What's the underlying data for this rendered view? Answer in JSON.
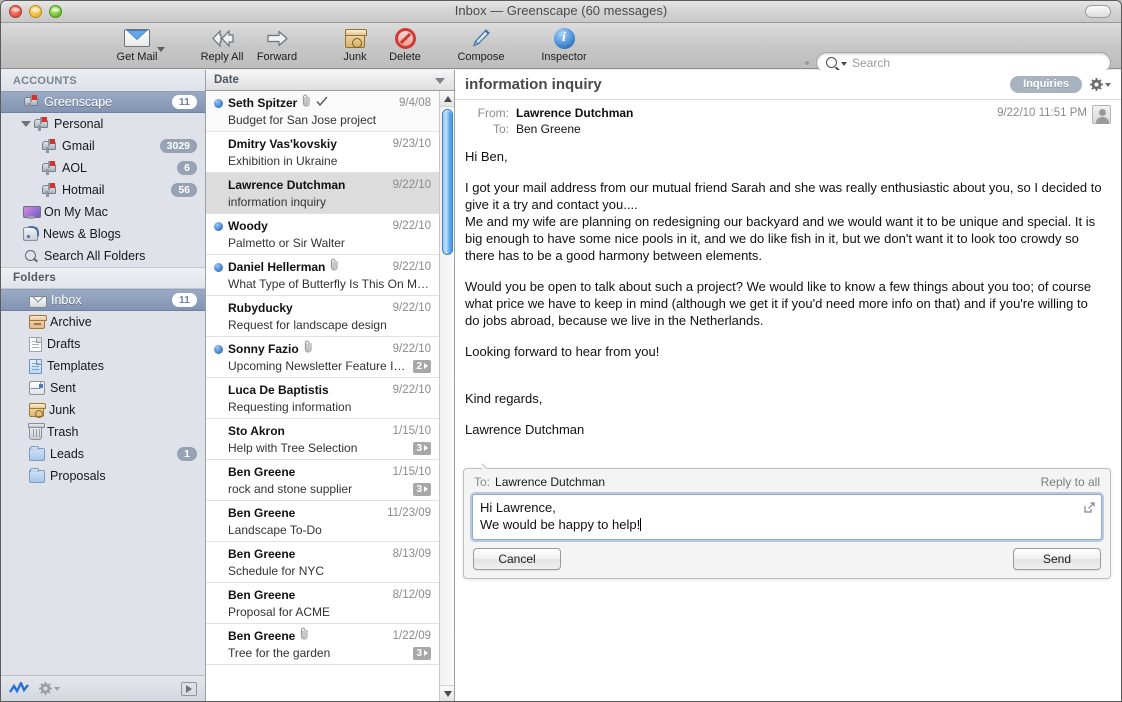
{
  "window": {
    "title": "Inbox — Greenscape (60 messages)"
  },
  "toolbar": {
    "items": [
      {
        "label": "Get Mail",
        "icon": "envelope-icon"
      },
      {
        "label": "Reply All",
        "icon": "double-arrow-left-icon"
      },
      {
        "label": "Forward",
        "icon": "arrow-right-icon"
      },
      {
        "label": "Junk",
        "icon": "junk-box-icon"
      },
      {
        "label": "Delete",
        "icon": "delete-circle-icon"
      },
      {
        "label": "Compose",
        "icon": "pen-icon"
      },
      {
        "label": "Inspector",
        "icon": "info-icon"
      }
    ],
    "search_placeholder": "Search"
  },
  "sidebar": {
    "accounts_header": "ACCOUNTS",
    "accounts": [
      {
        "label": "Greenscape",
        "badge": "11",
        "icon": "mailbox-icon",
        "indent": 1,
        "selected": true
      },
      {
        "label": "Personal",
        "badge": "",
        "icon": "mailbox-icon",
        "indent": 1,
        "disclosure": true
      },
      {
        "label": "Gmail",
        "badge": "3029",
        "icon": "mailbox-icon",
        "indent": 2
      },
      {
        "label": "AOL",
        "badge": "6",
        "icon": "mailbox-icon",
        "indent": 2
      },
      {
        "label": "Hotmail",
        "badge": "56",
        "icon": "mailbox-icon",
        "indent": 2
      },
      {
        "label": "On My Mac",
        "badge": "",
        "icon": "screen-icon",
        "indent": 1
      },
      {
        "label": "News & Blogs",
        "badge": "",
        "icon": "rss-icon",
        "indent": 1
      },
      {
        "label": "Search All Folders",
        "badge": "",
        "icon": "magnifier-icon",
        "indent": 1
      }
    ],
    "folders_header": "Folders",
    "folders": [
      {
        "label": "Inbox",
        "badge": "11",
        "icon": "inbox-tray-icon",
        "selected": true
      },
      {
        "label": "Archive",
        "badge": "",
        "icon": "archive-box-icon"
      },
      {
        "label": "Drafts",
        "badge": "",
        "icon": "document-icon"
      },
      {
        "label": "Templates",
        "badge": "",
        "icon": "document-blue-icon"
      },
      {
        "label": "Sent",
        "badge": "",
        "icon": "sent-envelope-icon"
      },
      {
        "label": "Junk",
        "badge": "",
        "icon": "junk-box-icon"
      },
      {
        "label": "Trash",
        "badge": "",
        "icon": "trash-icon"
      },
      {
        "label": "Leads",
        "badge": "1",
        "icon": "folder-icon"
      },
      {
        "label": "Proposals",
        "badge": "",
        "icon": "folder-icon"
      }
    ],
    "status_bar": {
      "activity_icon": "activity-chart-icon",
      "gear_icon": "gear-icon",
      "expand_icon": "show-pane-icon"
    }
  },
  "message_list": {
    "column_header": "Date",
    "rows": [
      {
        "sender": "Seth Spitzer",
        "subject": "Budget for San Jose project",
        "date": "9/4/08",
        "unread": true,
        "attachment": true,
        "replied": true,
        "thread": "",
        "selected": false
      },
      {
        "sender": "Dmitry Vas'kovskiy",
        "subject": "Exhibition in Ukraine",
        "date": "9/23/10",
        "unread": false,
        "attachment": false,
        "replied": false,
        "thread": "",
        "selected": false
      },
      {
        "sender": "Lawrence Dutchman",
        "subject": "information inquiry",
        "date": "9/22/10",
        "unread": false,
        "attachment": false,
        "replied": false,
        "thread": "",
        "selected": true
      },
      {
        "sender": "Woody",
        "subject": "Palmetto or Sir Walter",
        "date": "9/22/10",
        "unread": true,
        "attachment": false,
        "replied": false,
        "thread": "",
        "selected": false
      },
      {
        "sender": "Daniel Hellerman",
        "subject": "What Type of Butterfly Is This On M…",
        "date": "9/22/10",
        "unread": true,
        "attachment": true,
        "replied": false,
        "thread": "",
        "selected": false
      },
      {
        "sender": "Rubyducky",
        "subject": "Request for landscape design",
        "date": "9/22/10",
        "unread": false,
        "attachment": false,
        "replied": false,
        "thread": "",
        "selected": false
      },
      {
        "sender": "Sonny Fazio",
        "subject": "Upcoming Newsletter Feature I…",
        "date": "9/22/10",
        "unread": true,
        "attachment": true,
        "replied": false,
        "thread": "2",
        "selected": false
      },
      {
        "sender": "Luca De Baptistis",
        "subject": "Requesting information",
        "date": "9/22/10",
        "unread": false,
        "attachment": false,
        "replied": false,
        "thread": "",
        "selected": false
      },
      {
        "sender": "Sto Akron",
        "subject": "Help with Tree Selection",
        "date": "1/15/10",
        "unread": false,
        "attachment": false,
        "replied": false,
        "thread": "3",
        "selected": false
      },
      {
        "sender": "Ben Greene",
        "subject": "rock and stone supplier",
        "date": "1/15/10",
        "unread": false,
        "attachment": false,
        "replied": false,
        "thread": "3",
        "selected": false
      },
      {
        "sender": "Ben Greene",
        "subject": "Landscape To-Do",
        "date": "11/23/09",
        "unread": false,
        "attachment": false,
        "replied": false,
        "thread": "",
        "selected": false
      },
      {
        "sender": "Ben Greene",
        "subject": "Schedule for NYC",
        "date": "8/13/09",
        "unread": false,
        "attachment": false,
        "replied": false,
        "thread": "",
        "selected": false
      },
      {
        "sender": "Ben Greene",
        "subject": "Proposal for ACME",
        "date": "8/12/09",
        "unread": false,
        "attachment": false,
        "replied": false,
        "thread": "",
        "selected": false
      },
      {
        "sender": "Ben Greene",
        "subject": "Tree for the garden",
        "date": "1/22/09",
        "unread": false,
        "attachment": true,
        "replied": false,
        "thread": "3",
        "selected": false
      }
    ]
  },
  "message": {
    "subject": "information inquiry",
    "tag": "Inquiries",
    "from_label": "From:",
    "from": "Lawrence Dutchman",
    "to_label": "To:",
    "to": "Ben Greene",
    "timestamp": "9/22/10 11:51 PM",
    "body": [
      "Hi Ben,",
      "I got your mail address from our mutual friend Sarah and she was really enthusiastic about you, so I decided to give it a try and contact you....",
      "Me and my wife are planning on redesigning our backyard and we would want it to be unique and special. It is big enough to have some nice pools in it, and we do like fish in it, but we don't want it to look too crowdy so there has to be a good harmony between elements.",
      "Would you be open to talk about such a project? We would like to know a few things about you too; of course what price we have to keep in mind (although we get it if you'd need more info on that) and if you're willing to do jobs abroad, because we live in the Netherlands.",
      "Looking forward to hear from you!",
      "Kind regards,",
      "Lawrence Dutchman"
    ]
  },
  "reply": {
    "to_label": "To:",
    "to": "Lawrence Dutchman",
    "reply_to_all": "Reply to all",
    "text_line1": "Hi Lawrence,",
    "text_line2": "We would be happy to help!",
    "cancel_label": "Cancel",
    "send_label": "Send",
    "popout_icon": "popout-icon"
  },
  "colors": {
    "selection_blue": "#8294b3",
    "badge_gray": "#97a3b4",
    "unread_dot": "#3c7fd0",
    "scrollbar_aqua": "#58a6ee",
    "tag_badge": "#a9b2bf"
  }
}
